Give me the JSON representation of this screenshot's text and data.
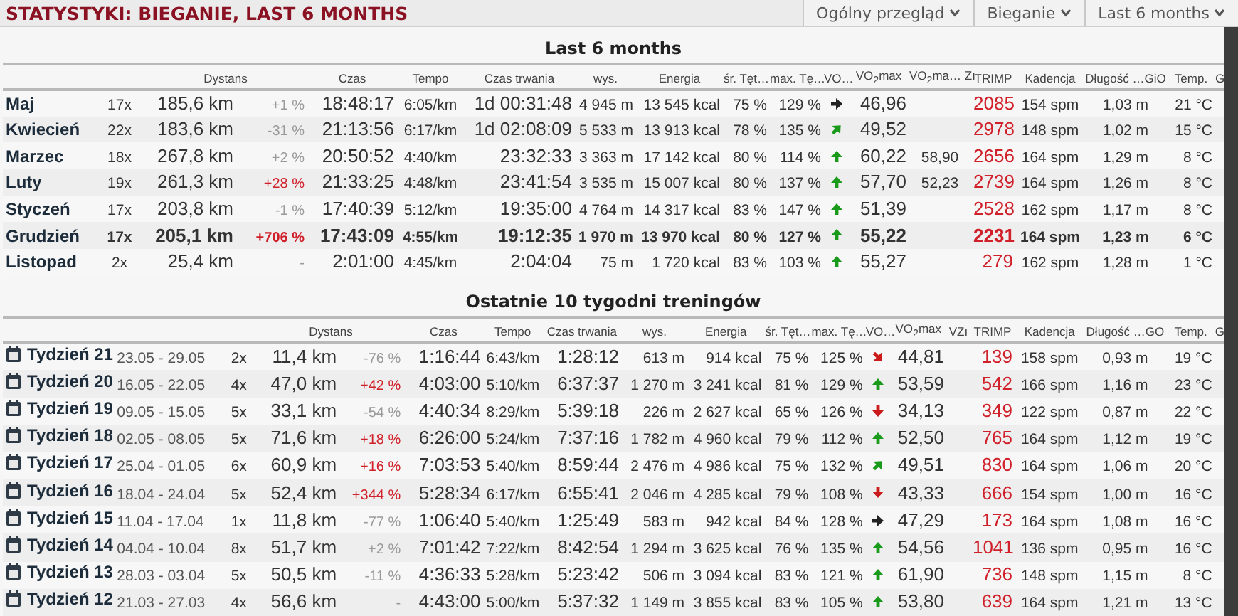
{
  "title": "STATYSTYKI: BIEGANIE, LAST 6 MONTHS",
  "dropdowns": [
    {
      "label": "Ogólny przegląd"
    },
    {
      "label": "Bieganie"
    },
    {
      "label": "Last 6 months"
    }
  ],
  "months": {
    "title": "Last 6 months",
    "headers": [
      "Dystans",
      "Czas",
      "Tempo",
      "Czas trwania",
      "wys.",
      "Energia",
      "śr. Tęt…",
      "max. Tę…",
      "VO…",
      "VO$_{2}$max",
      "VO$_{2}$ma… Zı",
      "TRIMP",
      "Kadencja",
      "Długość …GiO",
      "Temp.",
      "G"
    ],
    "rows": [
      {
        "name": "Maj",
        "bold": false,
        "count": "17x",
        "distance": "185,6 km",
        "change": "+1 %",
        "change_highlight": false,
        "time": "18:48:17",
        "pace": "6:05/km",
        "duration": "1d 00:31:48",
        "elevation": "4 945 m",
        "energy": "13 545 kcal",
        "avg_hr": "75 %",
        "max_hr": "129 %",
        "trend": {
          "kind": "right"
        },
        "vo2max": "46,96",
        "trimp": "2085",
        "cadence": "154 spm",
        "stride": "1,03 m",
        "temp": "21 °C"
      },
      {
        "name": "Kwiecień",
        "bold": false,
        "count": "22x",
        "distance": "183,6 km",
        "change": "-31 %",
        "change_highlight": false,
        "time": "21:13:56",
        "pace": "6:17/km",
        "duration": "1d 02:08:09",
        "elevation": "5 533 m",
        "energy": "13 913 kcal",
        "avg_hr": "78 %",
        "max_hr": "135 %",
        "trend": {
          "kind": "up-right"
        },
        "vo2max": "49,52",
        "trimp": "2978",
        "cadence": "148 spm",
        "stride": "1,02 m",
        "temp": "15 °C"
      },
      {
        "name": "Marzec",
        "bold": false,
        "count": "18x",
        "distance": "267,8 km",
        "change": "+2 %",
        "change_highlight": false,
        "time": "20:50:52",
        "pace": "4:40/km",
        "duration": "23:32:33",
        "elevation": "3 363 m",
        "energy": "17 142 kcal",
        "avg_hr": "80 %",
        "max_hr": "114 %",
        "trend": {
          "kind": "up"
        },
        "vo2max": "60,22",
        "vo2max_zr": "58,90",
        "trimp": "2656",
        "cadence": "164 spm",
        "stride": "1,29 m",
        "temp": "8 °C"
      },
      {
        "name": "Luty",
        "bold": false,
        "count": "19x",
        "distance": "261,3 km",
        "change": "+28 %",
        "change_highlight": true,
        "time": "21:33:25",
        "pace": "4:48/km",
        "duration": "23:41:54",
        "elevation": "3 535 m",
        "energy": "15 007 kcal",
        "avg_hr": "80 %",
        "max_hr": "137 %",
        "trend": {
          "kind": "up"
        },
        "vo2max": "57,70",
        "vo2max_zr": "52,23",
        "trimp": "2739",
        "cadence": "164 spm",
        "stride": "1,26 m",
        "temp": "8 °C"
      },
      {
        "name": "Styczeń",
        "bold": false,
        "count": "17x",
        "distance": "203,8 km",
        "change": "-1 %",
        "change_highlight": false,
        "time": "17:40:39",
        "pace": "5:12/km",
        "duration": "19:35:00",
        "elevation": "4 764 m",
        "energy": "14 317 kcal",
        "avg_hr": "83 %",
        "max_hr": "147 %",
        "trend": {
          "kind": "up"
        },
        "vo2max": "51,39",
        "trimp": "2528",
        "cadence": "162 spm",
        "stride": "1,17 m",
        "temp": "8 °C"
      },
      {
        "name": "Grudzień",
        "bold": true,
        "count": "17x",
        "distance": "205,1 km",
        "change": "+706 %",
        "change_highlight": true,
        "time": "17:43:09",
        "pace": "4:55/km",
        "duration": "19:12:35",
        "elevation": "1 970 m",
        "energy": "13 970 kcal",
        "avg_hr": "80 %",
        "max_hr": "127 %",
        "trend": {
          "kind": "up"
        },
        "vo2max": "55,22",
        "trimp": "2231",
        "cadence": "164 spm",
        "stride": "1,23 m",
        "temp": "6 °C"
      },
      {
        "name": "Listopad",
        "bold": false,
        "count": "2x",
        "distance": "25,4 km",
        "change": "-",
        "change_highlight": false,
        "time": "2:01:00",
        "pace": "4:45/km",
        "duration": "2:04:04",
        "elevation": "75 m",
        "energy": "1 720 kcal",
        "avg_hr": "83 %",
        "max_hr": "103 %",
        "trend": {
          "kind": "up"
        },
        "vo2max": "55,27",
        "trimp": "279",
        "cadence": "162 spm",
        "stride": "1,28 m",
        "temp": "1 °C"
      }
    ]
  },
  "weeks": {
    "title": "Ostatnie 10 tygodni treningów",
    "headers": [
      "Dystans",
      "Czas",
      "Tempo",
      "Czas trwania",
      "wys.",
      "Energia",
      "śr. Tęt…",
      "max. Tę…",
      "VO…",
      "VO$_{2}$max",
      "VZı",
      "TRIMP",
      "Kadencja",
      "Długość …GO",
      "Temp.",
      "G"
    ],
    "rows": [
      {
        "name": "Tydzień 21",
        "dates": "23.05 - 29.05",
        "count": "2x",
        "distance": "11,4 km",
        "change": "-76 %",
        "change_highlight": false,
        "time": "1:16:44",
        "pace": "6:43/km",
        "duration": "1:28:12",
        "elevation": "613 m",
        "energy": "914 kcal",
        "avg_hr": "75 %",
        "max_hr": "125 %",
        "trend": {
          "kind": "down-right"
        },
        "vo2max": "44,81",
        "trimp": "139",
        "cadence": "158 spm",
        "stride": "0,93 m",
        "temp": "19 °C"
      },
      {
        "name": "Tydzień 20",
        "dates": "16.05 - 22.05",
        "count": "4x",
        "distance": "47,0 km",
        "change": "+42 %",
        "change_highlight": true,
        "time": "4:03:00",
        "pace": "5:10/km",
        "duration": "6:37:37",
        "elevation": "1 270 m",
        "energy": "3 241 kcal",
        "avg_hr": "81 %",
        "max_hr": "129 %",
        "trend": {
          "kind": "up"
        },
        "vo2max": "53,59",
        "trimp": "542",
        "cadence": "166 spm",
        "stride": "1,16 m",
        "temp": "23 °C"
      },
      {
        "name": "Tydzień 19",
        "dates": "09.05 - 15.05",
        "count": "5x",
        "distance": "33,1 km",
        "change": "-54 %",
        "change_highlight": false,
        "time": "4:40:34",
        "pace": "8:29/km",
        "duration": "5:39:18",
        "elevation": "226 m",
        "energy": "2 627 kcal",
        "avg_hr": "65 %",
        "max_hr": "126 %",
        "trend": {
          "kind": "down"
        },
        "vo2max": "34,13",
        "trimp": "349",
        "cadence": "122 spm",
        "stride": "0,87 m",
        "temp": "22 °C"
      },
      {
        "name": "Tydzień 18",
        "dates": "02.05 - 08.05",
        "count": "5x",
        "distance": "71,6 km",
        "change": "+18 %",
        "change_highlight": true,
        "time": "6:26:00",
        "pace": "5:24/km",
        "duration": "7:37:16",
        "elevation": "1 782 m",
        "energy": "4 960 kcal",
        "avg_hr": "79 %",
        "max_hr": "112 %",
        "trend": {
          "kind": "up"
        },
        "vo2max": "52,50",
        "trimp": "765",
        "cadence": "164 spm",
        "stride": "1,12 m",
        "temp": "19 °C"
      },
      {
        "name": "Tydzień 17",
        "dates": "25.04 - 01.05",
        "count": "6x",
        "distance": "60,9 km",
        "change": "+16 %",
        "change_highlight": true,
        "time": "7:03:53",
        "pace": "5:40/km",
        "duration": "8:59:44",
        "elevation": "2 476 m",
        "energy": "4 986 kcal",
        "avg_hr": "75 %",
        "max_hr": "132 %",
        "trend": {
          "kind": "up-right"
        },
        "vo2max": "49,51",
        "trimp": "830",
        "cadence": "164 spm",
        "stride": "1,06 m",
        "temp": "20 °C"
      },
      {
        "name": "Tydzień 16",
        "dates": "18.04 - 24.04",
        "count": "5x",
        "distance": "52,4 km",
        "change": "+344 %",
        "change_highlight": true,
        "time": "5:28:34",
        "pace": "6:17/km",
        "duration": "6:55:41",
        "elevation": "2 046 m",
        "energy": "4 285 kcal",
        "avg_hr": "79 %",
        "max_hr": "108 %",
        "trend": {
          "kind": "down"
        },
        "vo2max": "43,33",
        "trimp": "666",
        "cadence": "154 spm",
        "stride": "1,00 m",
        "temp": "16 °C"
      },
      {
        "name": "Tydzień 15",
        "dates": "11.04 - 17.04",
        "count": "1x",
        "distance": "11,8 km",
        "change": "-77 %",
        "change_highlight": false,
        "time": "1:06:40",
        "pace": "5:40/km",
        "duration": "1:25:49",
        "elevation": "583 m",
        "energy": "942 kcal",
        "avg_hr": "84 %",
        "max_hr": "128 %",
        "trend": {
          "kind": "right"
        },
        "vo2max": "47,29",
        "trimp": "173",
        "cadence": "164 spm",
        "stride": "1,08 m",
        "temp": "16 °C"
      },
      {
        "name": "Tydzień 14",
        "dates": "04.04 - 10.04",
        "count": "8x",
        "distance": "51,7 km",
        "change": "+2 %",
        "change_highlight": false,
        "time": "7:01:42",
        "pace": "7:22/km",
        "duration": "8:42:54",
        "elevation": "1 294 m",
        "energy": "3 625 kcal",
        "avg_hr": "76 %",
        "max_hr": "135 %",
        "trend": {
          "kind": "up"
        },
        "vo2max": "54,56",
        "trimp": "1041",
        "cadence": "136 spm",
        "stride": "0,95 m",
        "temp": "16 °C"
      },
      {
        "name": "Tydzień 13",
        "dates": "28.03 - 03.04",
        "count": "5x",
        "distance": "50,5 km",
        "change": "-11 %",
        "change_highlight": false,
        "time": "4:36:33",
        "pace": "5:28/km",
        "duration": "5:23:42",
        "elevation": "506 m",
        "energy": "3 094 kcal",
        "avg_hr": "83 %",
        "max_hr": "121 %",
        "trend": {
          "kind": "up"
        },
        "vo2max": "61,90",
        "trimp": "736",
        "cadence": "148 spm",
        "stride": "1,15 m",
        "temp": "8 °C"
      },
      {
        "name": "Tydzień 12",
        "dates": "21.03 - 27.03",
        "count": "4x",
        "distance": "56,6 km",
        "change": "-",
        "change_highlight": false,
        "time": "4:43:00",
        "pace": "5:00/km",
        "duration": "5:37:32",
        "elevation": "1 149 m",
        "energy": "3 855 kcal",
        "avg_hr": "83 %",
        "max_hr": "105 %",
        "trend": {
          "kind": "up"
        },
        "vo2max": "53,80",
        "trimp": "639",
        "cadence": "164 spm",
        "stride": "1,21 m",
        "temp": "13 °C"
      }
    ]
  }
}
